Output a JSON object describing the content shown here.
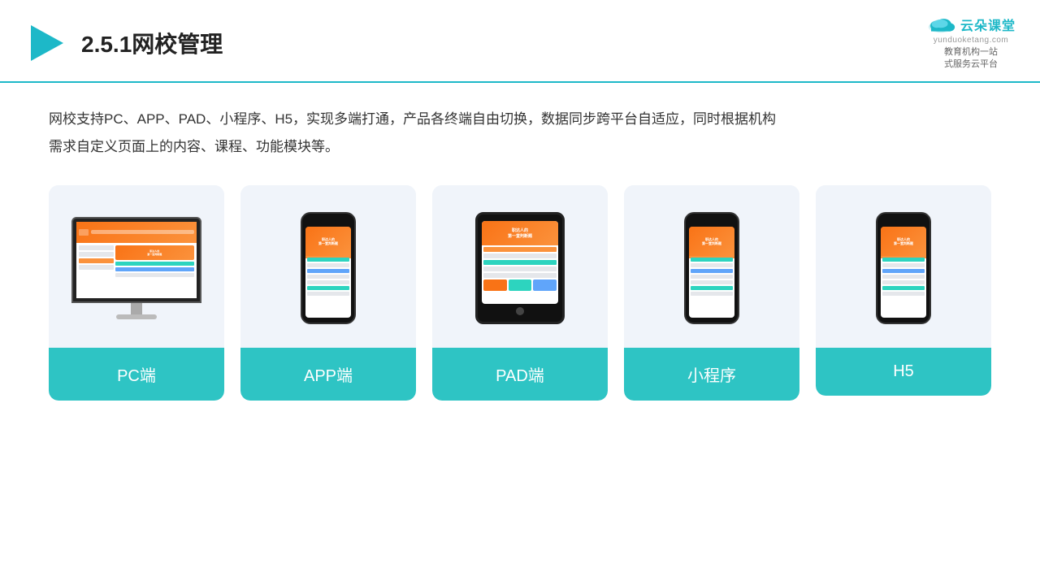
{
  "header": {
    "title": "2.5.1网校管理",
    "logo": {
      "cn": "云朵课堂",
      "en": "yunduoketang.com",
      "tagline": "教育机构一站\n式服务云平台"
    }
  },
  "description": "网校支持PC、APP、PAD、小程序、H5，实现多端打通，产品各终端自由切换，数据同步跨平台自适应，同时根据机构\n需求自定义页面上的内容、课程、功能模块等。",
  "cards": [
    {
      "id": "pc",
      "label": "PC端",
      "type": "pc"
    },
    {
      "id": "app",
      "label": "APP端",
      "type": "phone"
    },
    {
      "id": "pad",
      "label": "PAD端",
      "type": "tablet"
    },
    {
      "id": "miniapp",
      "label": "小程序",
      "type": "phone"
    },
    {
      "id": "h5",
      "label": "H5",
      "type": "phone"
    }
  ]
}
